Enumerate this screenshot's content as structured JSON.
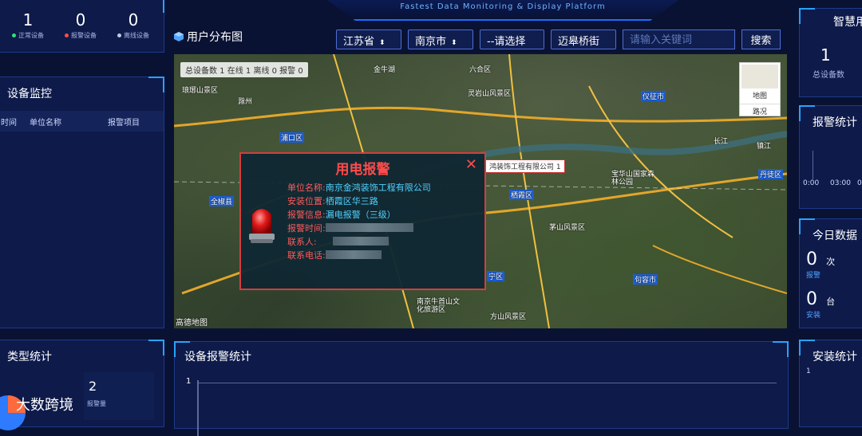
{
  "header": {
    "subtitle": "Fastest Data Monitoring & Display Platform"
  },
  "left_top": {
    "stats": [
      {
        "num": "1",
        "label": "正常设备",
        "color": "#2ee07a"
      },
      {
        "num": "0",
        "label": "报警设备",
        "color": "#ff4b4b"
      },
      {
        "num": "0",
        "label": "离线设备",
        "color": "#c0c8e0"
      }
    ]
  },
  "left_monitor": {
    "title": "设备监控",
    "columns": [
      "时间",
      "单位名称",
      "报警项目"
    ]
  },
  "left_type": {
    "title": "类型统计",
    "card_num": "2",
    "card_label": "报警量"
  },
  "map_section": {
    "title": "用户分布图",
    "province": "江苏省",
    "city": "南京市",
    "district": "--请选择",
    "street": "迈皋桥街",
    "search_placeholder": "请输入关键词",
    "search_button": "搜索",
    "stats_line": "总设备数 1   在线 1   离线 0   报警 0",
    "map_type_label": "地图",
    "traffic_label": "路况",
    "marker_label": "鸿装饰工程有限公司 1",
    "attribution": "高德地图",
    "places": [
      "琅琊山景区",
      "六合区",
      "六合区",
      "灵岩山风景区",
      "仪征市",
      "全椒县",
      "浦口区",
      "栖霞区",
      "句容市",
      "宁区",
      "茅山风景区",
      "丹徒区",
      "镇江",
      "滁州",
      "长江",
      "茅山风景区",
      "方山风景区",
      "南京牛首山文化旅游区",
      "宝华山国家森林公园",
      "金牛湖"
    ]
  },
  "popup": {
    "title": "用电报警",
    "rows": [
      {
        "k": "单位名称:",
        "v": "南京金鸿装饰工程有限公司"
      },
      {
        "k": "安装位置:",
        "v": "栖霞区华三路"
      },
      {
        "k": "报警信息:",
        "v": "漏电报警（三级）"
      },
      {
        "k": "报警时间:",
        "v": ""
      },
      {
        "k": "联系人:",
        "v": ""
      },
      {
        "k": "联系电话:",
        "v": ""
      }
    ]
  },
  "right_panels": {
    "smart": {
      "title": "智慧用",
      "num": "1",
      "label": "总设备数"
    },
    "alarm_stats": {
      "title": "报警统计",
      "ticks": [
        "0:00",
        "03:00",
        "0"
      ]
    },
    "today": {
      "title": "今日数据",
      "alarm_num": "0",
      "alarm_unit": "次",
      "alarm_label": "报警",
      "install_num": "0",
      "install_unit": "台",
      "install_label": "安装"
    },
    "install_stats": {
      "title": "安装统计",
      "tick": "1"
    }
  },
  "bottom_center": {
    "title": "设备报警统计",
    "y_tick": "1"
  },
  "watermark": "大数跨境"
}
